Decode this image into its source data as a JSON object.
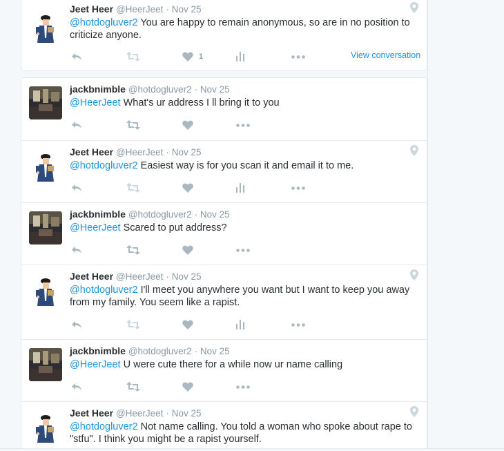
{
  "colors": {
    "link": "#1b95e0",
    "muted": "#8899a6",
    "text": "#292f33",
    "action_icon": "#aab8c2"
  },
  "first_tweet": {
    "name": "Jeet Heer",
    "handle": "@HeerJeet",
    "sep": "·",
    "date": "Nov 25",
    "mention": "@hotdogluver2",
    "text": " You are happy to remain anonymous, so are in no position to criticize anyone.",
    "like_count": "1",
    "view_conversation": "View conversation"
  },
  "thread": [
    {
      "name": "jackbnimble",
      "handle": "@hotdogluver2",
      "sep": "·",
      "date": "Nov 25",
      "mention": "@HeerJeet",
      "text": " What's ur address I ll bring it to you"
    },
    {
      "name": "Jeet Heer",
      "handle": "@HeerJeet",
      "sep": "·",
      "date": "Nov 25",
      "mention": "@hotdogluver2",
      "text": " Easiest way is for you scan it and email it to me."
    },
    {
      "name": "jackbnimble",
      "handle": "@hotdogluver2",
      "sep": "·",
      "date": "Nov 25",
      "mention": "@HeerJeet",
      "text": " Scared to put address?"
    },
    {
      "name": "Jeet Heer",
      "handle": "@HeerJeet",
      "sep": "·",
      "date": "Nov 25",
      "mention": "@hotdogluver2",
      "text": " I'll meet you anywhere you want but I want to keep you away from my family. You seem like a rapist."
    },
    {
      "name": "jackbnimble",
      "handle": "@hotdogluver2",
      "sep": "·",
      "date": "Nov 25",
      "mention": "@HeerJeet",
      "text": " U were cute there for a while now ur name calling"
    },
    {
      "name": "Jeet Heer",
      "handle": "@HeerJeet",
      "sep": "·",
      "date": "Nov 25",
      "mention": "@hotdogluver2",
      "text": " Not name calling. You told a woman who spoke about rape to \"stfu\". I think you might be a rapist yourself."
    }
  ]
}
